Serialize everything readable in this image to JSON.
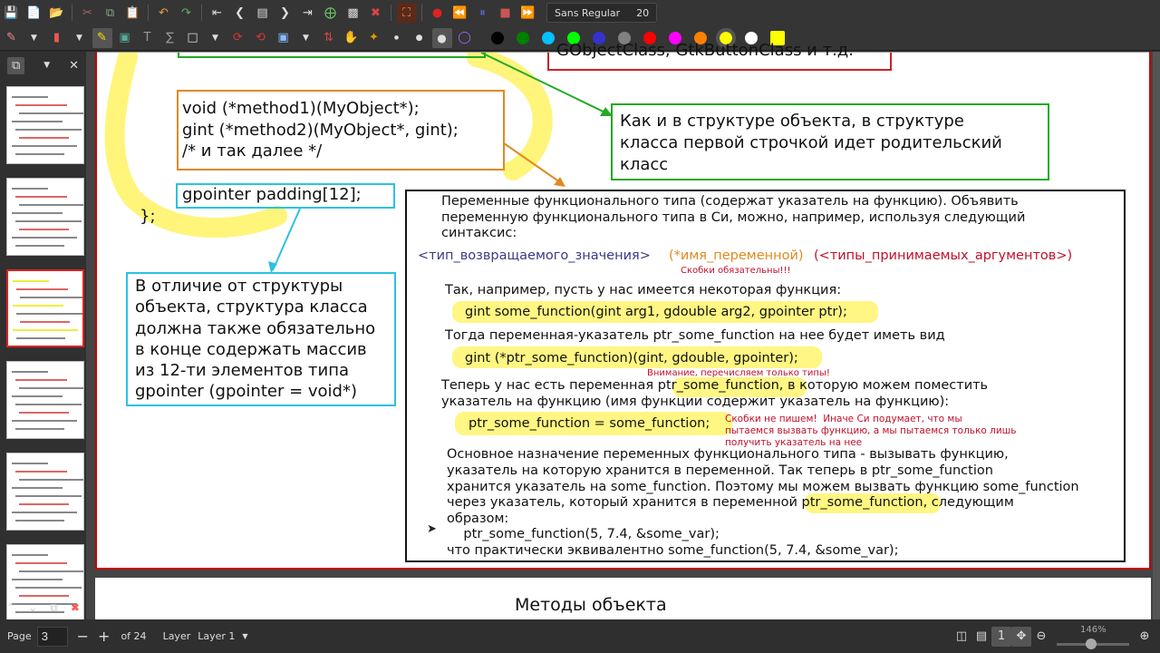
{
  "toolbar": {
    "font_name": "Sans Regular",
    "font_size": "20",
    "colors": [
      "#000000",
      "#008000",
      "#00c0ff",
      "#00ff00",
      "#3333cc",
      "#808080",
      "#ff0000",
      "#ff00ff",
      "#ff8000",
      "#ffff00",
      "#ffffff",
      "#ffff00"
    ]
  },
  "page": {
    "code_method1": "void (*method1)(MyObject*);",
    "code_method2": "gint (*method2)(MyObject*, gint);",
    "code_comment": "/* и так далее */",
    "code_padding": "gpointer padding[12];",
    "code_close": "};",
    "top_right_partial": "GObjectClass, GtkButtonClass и т.д.",
    "note_parent_class": "Как и в структуре объекта, в структуре\nкласса первой строчкой идет родительский\nкласс",
    "note_padding": "В отличие от структуры\nобъекта, структура класса\nдолжна также обязательно\nв конце содержать массив\nиз 12-ти элементов типа\ngpointer (gpointer = void*)",
    "intro": "Переменные функционального типа (содержат указатель на функцию). Объявить\nпеременную функционального типа в Си, можно, например, используя следующий\nсинтаксис:",
    "syntax_type": "<тип_возвращаемого_значения>",
    "syntax_name": "(*имя_переменной)",
    "syntax_args": "(<типы_принимаемых_аргументов>)",
    "note_brackets": "Скобки обязательны!!!",
    "example_intro": "Так, например, пусть у нас имеется некоторая функция:",
    "example_func": "gint some_function(gint arg1, gdouble arg2, gpointer ptr);",
    "pointer_intro": "Тогда переменная-указатель ptr_some_function на нее будет иметь вид",
    "pointer_decl": "gint (*ptr_some_function)(gint, gdouble, gpointer);",
    "note_types_only": "Внимание, перечисляем только типы!",
    "assign_intro_a": "Теперь у нас есть переменная ",
    "assign_intro_var": "ptr_some_function,",
    "assign_intro_b": " в которую можем поместить",
    "assign_intro_2": "указатель на функцию (имя функции содержит указатель на функцию):",
    "assign_code": "ptr_some_function = some_function;",
    "note_no_brackets": "Скобки не пишем!  Иначе Си подумает, что мы\nпытаемся вызвать функцию, а мы пытаемся только лишь\nполучить указатель на нее",
    "main_purpose": "Основное назначение переменных функционального типа - вызывать функцию,\nуказатель на которую хранится в переменной. Так теперь в ptr_some_function\nхранится указатель на some_function. Поэтому мы можем вызвать функцию some_function",
    "main_purpose_4a": "через указатель, который хранится в переменной ",
    "main_purpose_4var": "ptr_some_function,",
    "main_purpose_4b": " следующим",
    "main_purpose_5": "образом:",
    "call_code": "    ptr_some_function(5, 7.4, &some_var);",
    "equivalent": "что практически эквивалентно some_function(5, 7.4, &some_var);",
    "next_page_title": "Методы объекта"
  },
  "sidebar": {
    "page_count": 6
  },
  "status": {
    "page_label": "Page",
    "page_value": "3",
    "of_label": "of 24",
    "layer_label": "Layer",
    "layer_value": "Layer 1",
    "zoom": "146%"
  }
}
